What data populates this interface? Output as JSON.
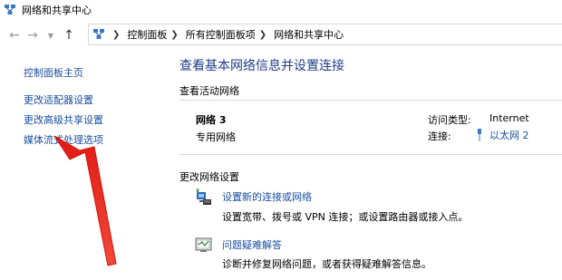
{
  "window": {
    "title": "网络和共享中心"
  },
  "navigation": {
    "back_icon": "back-arrow-icon",
    "forward_icon": "forward-arrow-icon",
    "up_icon": "up-arrow-icon"
  },
  "breadcrumb": [
    "控制面板",
    "所有控制面板项",
    "网络和共享中心"
  ],
  "sidebar": {
    "links": [
      "控制面板主页",
      "更改适配器设置",
      "更改高级共享设置",
      "媒体流式处理选项"
    ]
  },
  "main": {
    "title": "查看基本网络信息并设置连接",
    "active_networks_heading": "查看活动网络",
    "network": {
      "name": "网络 3",
      "type": "专用网络",
      "access_type_label": "访问类型:",
      "access_type_value": "Internet",
      "connection_label": "连接:",
      "connection_value": "以太网 2"
    },
    "change_settings_heading": "更改网络设置",
    "tasks": [
      {
        "link": "设置新的连接或网络",
        "description": "设置宽带、拨号或 VPN 连接；或设置路由器或接入点。"
      },
      {
        "link": "问题疑难解答",
        "description": "诊断并修复网络问题，或者获得疑难解答信息。"
      }
    ]
  },
  "colors": {
    "link": "#1a4fa0",
    "title": "#1e3e8a",
    "annotation_arrow": "#e8231b"
  }
}
